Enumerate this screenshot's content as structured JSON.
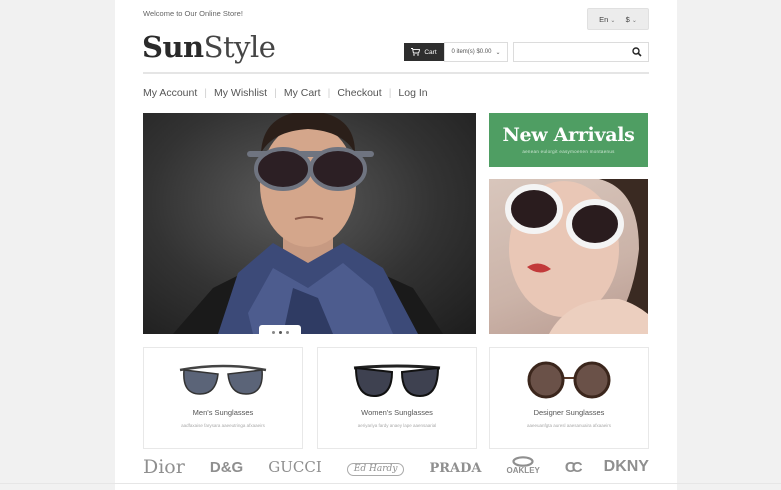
{
  "header": {
    "welcome": "Welcome to Our Online Store!",
    "language": "En",
    "currency": "$"
  },
  "logo": {
    "part1": "Sun",
    "part2": "Style"
  },
  "cart": {
    "label": "Cart",
    "summary": "0 item(s) $0.00"
  },
  "search": {
    "placeholder": "",
    "icon": "search-icon"
  },
  "nav": [
    "My Account",
    "My Wishlist",
    "My Cart",
    "Checkout",
    "Log In"
  ],
  "slider": {
    "active_dot": 1,
    "dot_count": 3
  },
  "promo": {
    "title": "New Arrivals",
    "subtitle": "aenean eulorgit easymoenen montaenus"
  },
  "categories": [
    {
      "name": "Men's Sunglasses",
      "desc": "aadfaxaise farysara aaeeutringa afxaaeirs"
    },
    {
      "name": "Women's Sunglasses",
      "desc": "aeriyariya fardy anaey lape aaensaarial"
    },
    {
      "name": "Designer Sunglasses",
      "desc": "aaeeuanfgta auresl aaesanuaira afxaaeirs"
    }
  ],
  "brands": [
    "Dior",
    "D&G",
    "GUCCI",
    "Ed Hardy",
    "PRADA",
    "OAKLEY",
    "CC",
    "DKNY"
  ],
  "colors": {
    "accent_green": "#4f9e63",
    "cart_dark": "#2e2e2e",
    "page_bg": "#f1f1f1"
  }
}
